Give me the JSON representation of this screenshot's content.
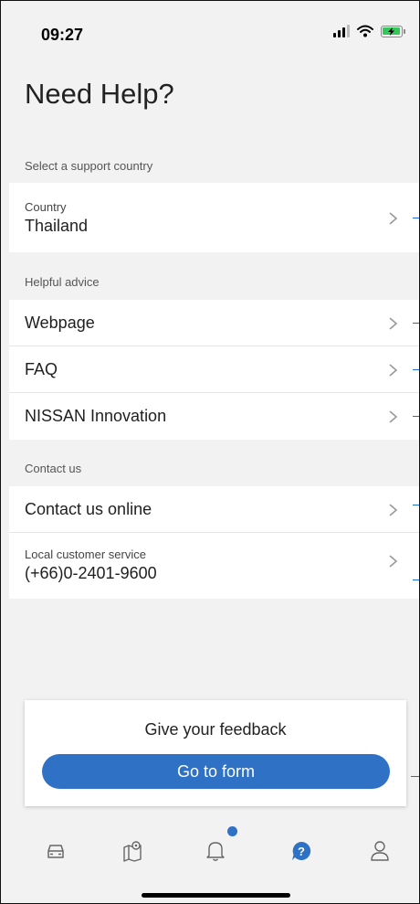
{
  "status": {
    "time": "09:27"
  },
  "page": {
    "title": "Need Help?"
  },
  "sections": {
    "country": {
      "label": "Select a support country",
      "row": {
        "sub": "Country",
        "value": "Thailand"
      }
    },
    "advice": {
      "label": "Helpful advice",
      "items": [
        {
          "label": "Webpage"
        },
        {
          "label": "FAQ"
        },
        {
          "label": "NISSAN Innovation"
        }
      ]
    },
    "contact": {
      "label": "Contact us",
      "online": {
        "label": "Contact us online"
      },
      "phone": {
        "sub": "Local customer service",
        "value": "(+66)0-2401-9600"
      }
    }
  },
  "feedback": {
    "title": "Give your feedback",
    "button_label": "Go to form"
  },
  "tabbar": {
    "items": [
      {
        "icon": "car-icon",
        "active": false
      },
      {
        "icon": "map-pin-icon",
        "active": false
      },
      {
        "icon": "bell-icon",
        "active": false,
        "has_badge": true
      },
      {
        "icon": "help-icon",
        "active": true
      },
      {
        "icon": "profile-icon",
        "active": false
      }
    ]
  },
  "colors": {
    "accent": "#2f71c4",
    "background": "#f2f2f2",
    "row_bg": "#ffffff"
  }
}
